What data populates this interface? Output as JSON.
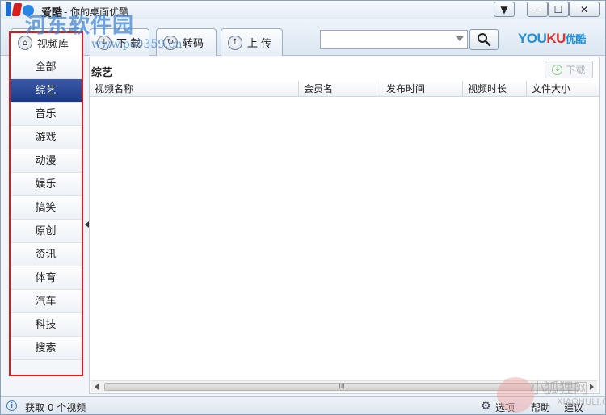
{
  "titlebar": {
    "app_name": "爱酷",
    "subtitle": "- 你的桌面优酷",
    "watermark_main": "河东软件园",
    "watermark_url": "www.pc0359.cn",
    "min_label": "—",
    "max_label": "☐",
    "close_label": "✕",
    "menu_label": "▼"
  },
  "tabs": [
    {
      "label": "视频库",
      "icon": "home-icon"
    },
    {
      "label": "下 载",
      "icon": "download-icon"
    },
    {
      "label": "转码",
      "icon": "convert-icon"
    },
    {
      "label": "上 传",
      "icon": "upload-icon"
    }
  ],
  "search": {
    "placeholder": "",
    "button_icon": "search-icon"
  },
  "brand": {
    "part1": "YOU",
    "part2": "KU",
    "part3": "优酷"
  },
  "sidebar": {
    "items": [
      {
        "label": "全部",
        "active": false
      },
      {
        "label": "综艺",
        "active": true
      },
      {
        "label": "音乐",
        "active": false
      },
      {
        "label": "游戏",
        "active": false
      },
      {
        "label": "动漫",
        "active": false
      },
      {
        "label": "娱乐",
        "active": false
      },
      {
        "label": "搞笑",
        "active": false
      },
      {
        "label": "原创",
        "active": false
      },
      {
        "label": "资讯",
        "active": false
      },
      {
        "label": "体育",
        "active": false
      },
      {
        "label": "汽车",
        "active": false
      },
      {
        "label": "科技",
        "active": false
      },
      {
        "label": "搜索",
        "active": false
      }
    ]
  },
  "main": {
    "title": "综艺",
    "download_button": "下载",
    "columns": [
      "视频名称",
      "会员名",
      "发布时间",
      "视频时长",
      "文件大小"
    ],
    "scroll_thumb": "III"
  },
  "status": {
    "text": "获取 0 个视频",
    "options": "选项",
    "help": "帮助",
    "suggest": "建议",
    "fox_watermark": "小狐狸网",
    "fox_sub": "XIAOHULI.CN"
  },
  "colors": {
    "accent": "#1b3a86",
    "highlight_border": "#e01818",
    "brand_blue": "#1d8fe1",
    "brand_red": "#e3312d"
  }
}
